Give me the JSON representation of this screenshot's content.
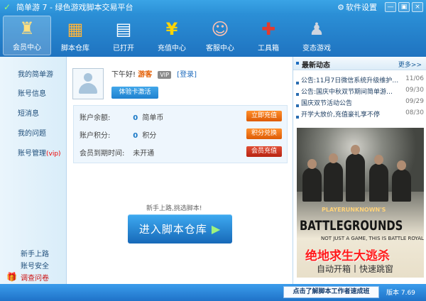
{
  "title": "简单游 7 - 绿色游戏脚本交易平台",
  "settings_label": "软件设置",
  "window_buttons": [
    "最小化",
    "还原",
    "关闭"
  ],
  "nav": [
    {
      "label": "会员中心",
      "icon": "member-icon"
    },
    {
      "label": "脚本仓库",
      "icon": "store-icon"
    },
    {
      "label": "已打开",
      "icon": "opened-icon"
    },
    {
      "label": "充值中心",
      "icon": "recharge-icon"
    },
    {
      "label": "客服中心",
      "icon": "service-icon"
    },
    {
      "label": "工具箱",
      "icon": "tools-icon"
    },
    {
      "label": "变态游戏",
      "icon": "game-controller-icon"
    }
  ],
  "sidebar": {
    "items": [
      "我的简单游",
      "账号信息",
      "短消息",
      "我的问题",
      "账号管理"
    ],
    "vip_tag": "(vip)",
    "bottom": [
      "新手上路",
      "账号安全",
      "调查问卷"
    ]
  },
  "main": {
    "greeting": "下午好!",
    "user_status": "游客",
    "vip_badge": "VIP",
    "login": "[登录]",
    "trial_button": "体验卡激活",
    "account": [
      {
        "label": "账户余额:",
        "value": "0",
        "unit": "简单币",
        "button": "立即充值"
      },
      {
        "label": "账户积分:",
        "value": "0",
        "unit": "积分",
        "button": "积分兑换"
      },
      {
        "label": "会员到期时间:",
        "value": "未开通",
        "unit": "",
        "button": "会员充值"
      }
    ],
    "hint": "新手上路,挑选脚本!",
    "big_button": "进入脚本仓库"
  },
  "news": {
    "title": "最新动态",
    "more": "更多>>",
    "items": [
      {
        "text": "公告:11月7日微信系统升级维护…",
        "date": "11/06"
      },
      {
        "text": "公告:国庆中秋双节期间简单游…",
        "date": "09/30"
      },
      {
        "text": "国庆双节活动公告",
        "date": "09/29"
      },
      {
        "text": "开学大放价,充值豪礼享不停",
        "date": "08/30"
      }
    ]
  },
  "ad": {
    "top": "PLAYERUNKNOWN'S",
    "title": "BATTLEGROUNDS",
    "sub": "NOT JUST A GAME, THIS IS BATTLE ROYALE",
    "cn": "绝地求生大逃杀",
    "bottom": "自动开箱丨快速跳窗"
  },
  "status": {
    "tutorial": "点击了解脚本工作者速成班",
    "version": "版本 7.69"
  }
}
